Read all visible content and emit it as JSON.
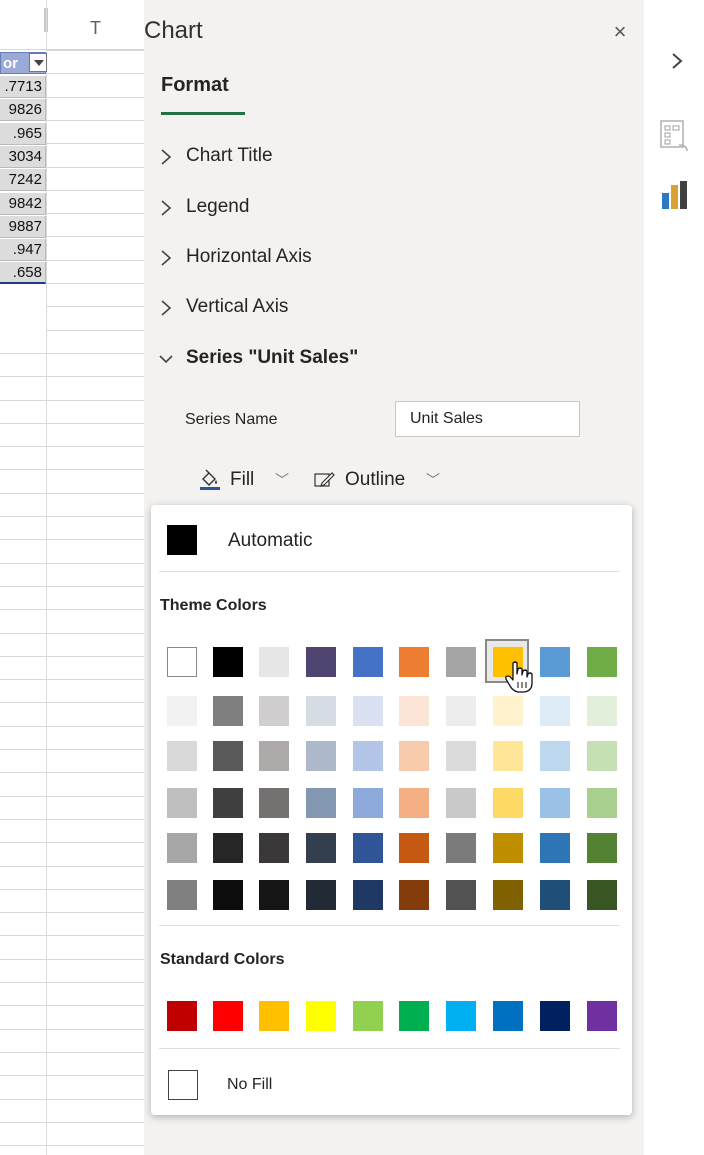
{
  "sheet": {
    "column_header": "T",
    "header_cell_text": "or",
    "cells": [
      ".7713",
      "9826",
      ".965",
      "3034",
      "7242",
      "9842",
      "9887",
      ".947",
      ".658"
    ]
  },
  "pane": {
    "title": "Chart",
    "close_icon": "×",
    "tab_format": "Format",
    "sections": [
      {
        "label": "Chart Title",
        "expanded": false
      },
      {
        "label": "Legend",
        "expanded": false
      },
      {
        "label": "Horizontal Axis",
        "expanded": false
      },
      {
        "label": "Vertical Axis",
        "expanded": false
      },
      {
        "label": "Series \"Unit Sales\"",
        "expanded": true
      }
    ],
    "series_name_label": "Series Name",
    "series_name_value": "Unit Sales",
    "fill_label": "Fill",
    "outline_label": "Outline"
  },
  "dropdown": {
    "automatic_label": "Automatic",
    "theme_colors_heading": "Theme Colors",
    "standard_colors_heading": "Standard Colors",
    "no_fill_label": "No Fill",
    "selected_theme_index": 7,
    "theme_colors": [
      [
        "#ffffff",
        "#000000",
        "#e7e6e6",
        "#4f4570",
        "#4472c4",
        "#ed7d31",
        "#a5a5a5",
        "#ffc000",
        "#5b9bd5",
        "#70ad47"
      ],
      [
        "#f2f2f2",
        "#7f7f7f",
        "#d0cece",
        "#d6dce4",
        "#d9e1f2",
        "#fce4d6",
        "#ededed",
        "#fff2cc",
        "#ddebf7",
        "#e2efda"
      ],
      [
        "#d9d9d9",
        "#595959",
        "#aeaaaa",
        "#adb9ca",
        "#b4c6e7",
        "#f8cbad",
        "#dbdbdb",
        "#ffe699",
        "#bdd7ee",
        "#c6e0b4"
      ],
      [
        "#bfbfbf",
        "#404040",
        "#757171",
        "#8497b0",
        "#8ea9db",
        "#f4b084",
        "#c9c9c9",
        "#ffd966",
        "#9bc2e6",
        "#a9d08e"
      ],
      [
        "#a6a6a6",
        "#262626",
        "#3a3838",
        "#333f4f",
        "#2f5597",
        "#c65911",
        "#7b7b7b",
        "#bf8f00",
        "#2e75b6",
        "#548235"
      ],
      [
        "#808080",
        "#0d0d0d",
        "#171616",
        "#222b35",
        "#1f3864",
        "#843c0c",
        "#525252",
        "#806000",
        "#1f4e78",
        "#375623"
      ]
    ],
    "standard_colors": [
      "#c00000",
      "#ff0000",
      "#ffc000",
      "#ffff00",
      "#92d050",
      "#00b050",
      "#00b0f0",
      "#0070c0",
      "#002060",
      "#7030a0"
    ]
  },
  "rail": {
    "expand_icon": "chevron-right-icon",
    "fields_icon": "field-list-icon",
    "chart_icon": "chart-icon"
  }
}
